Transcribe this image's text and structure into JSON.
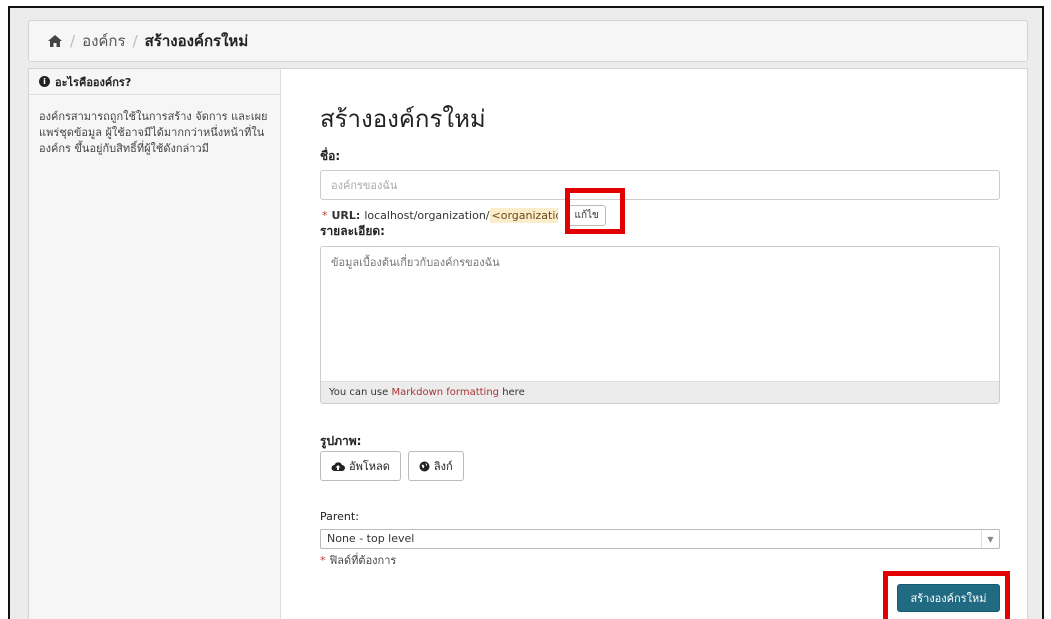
{
  "breadcrumb": {
    "home_icon": "home-icon",
    "items": [
      "องค์กร",
      "สร้างองค์กรใหม่"
    ]
  },
  "sidebar": {
    "heading": "อะไรคือองค์กร?",
    "info_icon": "info-icon",
    "body": "องค์กรสามารถถูกใช้ในการสร้าง จัดการ และเผยแพร่ชุดข้อมูล ผู้ใช้อาจมีได้มากกว่าหนึ่งหน้าที่ในองค์กร ขึ้นอยู่กับสิทธิ์ที่ผู้ใช้ดังกล่าวมี"
  },
  "form": {
    "title": "สร้างองค์กรใหม่",
    "name_label": "ชื่อ:",
    "name_placeholder": "องค์กรของฉัน",
    "url_required_mark": "*",
    "url_label": "URL:",
    "url_prefix": "localhost/organization/",
    "url_slug": "<organization>",
    "url_edit_button": "แก้ไข",
    "description_label": "รายละเอียด:",
    "description_placeholder": "ข้อมูลเบื้องต้นเกี่ยวกับองค์กรของฉัน",
    "markdown_prefix": "You can use ",
    "markdown_link": "Markdown formatting",
    "markdown_suffix": " here",
    "image_label": "รูปภาพ:",
    "upload_button": "อัพโหลด",
    "upload_icon": "cloud-upload-icon",
    "link_button": "ลิงก์",
    "link_icon": "globe-icon",
    "parent_label": "Parent:",
    "parent_value": "None - top level",
    "required_mark": "*",
    "required_note": "ฟิลด์ที่ต้องการ",
    "submit_button": "สร้างองค์กรใหม่"
  },
  "colors": {
    "highlight": "#e30000",
    "submit": "#206b82",
    "link": "#a33333"
  }
}
